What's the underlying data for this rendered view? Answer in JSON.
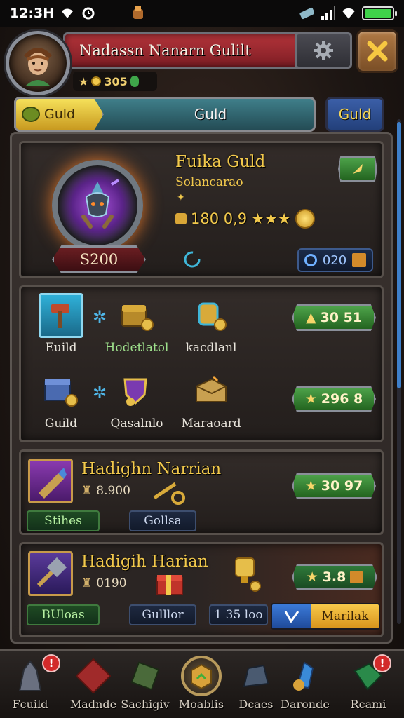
{
  "status_bar": {
    "time": "12:3H",
    "colors": {
      "battery": "#3fd34a"
    }
  },
  "header": {
    "title": "Nadassn Nanarn Gulilt",
    "currency_value": "305",
    "icons": [
      "avatar",
      "gear-icon",
      "close-icon",
      "coin-icon"
    ]
  },
  "tabs": {
    "active_label": "Guld",
    "middle_label": "Guld",
    "right_label": "Guld"
  },
  "featured_guild": {
    "name": "Fuika Guld",
    "subtitle": "Solancarao",
    "stat_value": "180 0,9",
    "power": "S200",
    "online_count": "020"
  },
  "items_panel": {
    "row1": {
      "items": [
        {
          "label": "Euild",
          "icon": "hammer-icon"
        },
        {
          "label": "Hodetlatol",
          "icon": "chest-icon"
        },
        {
          "label": "kacdlanl",
          "icon": "potion-icon"
        }
      ],
      "button_value": "30 51"
    },
    "row2": {
      "items": [
        {
          "label": "Guild",
          "icon": "crate-icon"
        },
        {
          "label": "Qasalnlo",
          "icon": "shield-icon"
        },
        {
          "label": "Maraoard",
          "icon": "box-icon"
        }
      ],
      "button_value": "296 8"
    }
  },
  "entry1": {
    "title": "Hadighn Narrian",
    "stat": "8.900",
    "tag_green": "Stihes",
    "tag_navy": "Gollsa",
    "button_value": "30 97"
  },
  "entry2": {
    "title": "Hadigih Harian",
    "stat": "0190",
    "tag_green": "BUloas",
    "tag_navy": "Gulllor",
    "count_pill": "1 35 loo",
    "button_value": "3.8",
    "action_label": "Marilak"
  },
  "bottom_nav": [
    {
      "label": "Fcuild",
      "badge": "!"
    },
    {
      "label": "Madnde"
    },
    {
      "label": "Sachigiv"
    },
    {
      "label": "Moablis"
    },
    {
      "label": "Dcaes"
    },
    {
      "label": "Daronde"
    },
    {
      "label": "Rcami",
      "badge": "!"
    }
  ]
}
